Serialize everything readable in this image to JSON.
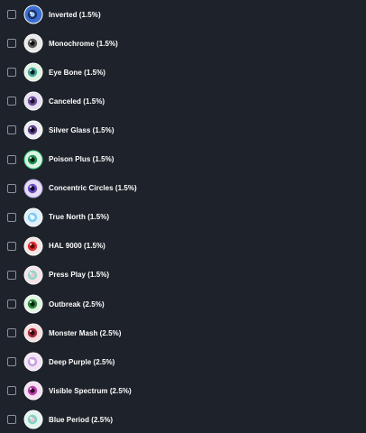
{
  "items": [
    {
      "label": "Inverted (1.5%)",
      "icon": "inverted-eyeball-icon",
      "sclera": "#3a6fd0",
      "rim": "#ffffff",
      "iris": "#1b2f6b",
      "pupil": "#9fd0ff"
    },
    {
      "label": "Monochrome (1.5%)",
      "icon": "monochrome-eyeball-icon",
      "sclera": "#e9e9e9",
      "rim": "#ffffff",
      "iris": "#5a5a5a",
      "pupil": "#111111"
    },
    {
      "label": "Eye Bone (1.5%)",
      "icon": "eye-bone-eyeball-icon",
      "sclera": "#dff3df",
      "rim": "#ffffff",
      "iris": "#3ea8a0",
      "pupil": "#0f1a1a"
    },
    {
      "label": "Canceled (1.5%)",
      "icon": "canceled-eyeball-icon",
      "sclera": "#e6dff0",
      "rim": "#ffffff",
      "iris": "#6a4aa0",
      "pupil": "#1a1024"
    },
    {
      "label": "Silver Glass (1.5%)",
      "icon": "silver-glass-eyeball-icon",
      "sclera": "#ececf2",
      "rim": "#ffffff",
      "iris": "#5c3e8c",
      "pupil": "#120a1e"
    },
    {
      "label": "Poison Plus (1.5%)",
      "icon": "poison-plus-eyeball-icon",
      "sclera": "#d9f5e4",
      "rim": "#3fd48a",
      "iris": "#1e8f52",
      "pupil": "#0c1a12"
    },
    {
      "label": "Concentric Circles (1.5%)",
      "icon": "concentric-circles-eyeball-icon",
      "sclera": "#e6def6",
      "rim": "#b9a4e8",
      "iris": "#6b4dc4",
      "pupil": "#140c2a"
    },
    {
      "label": "True North (1.5%)",
      "icon": "true-north-eyeball-icon",
      "sclera": "#dff0fb",
      "rim": "#ffffff",
      "iris": "#7fc8f0",
      "pupil": "#e8f6ff"
    },
    {
      "label": "HAL 9000 (1.5%)",
      "icon": "hal-9000-eyeball-icon",
      "sclera": "#f4e6e6",
      "rim": "#ffffff",
      "iris": "#e03030",
      "pupil": "#5a0a0a"
    },
    {
      "label": "Press Play (1.5%)",
      "icon": "press-play-eyeball-icon",
      "sclera": "#f6e2ea",
      "rim": "#ffffff",
      "iris": "#8fd9c8",
      "pupil": "#f0c6d6"
    },
    {
      "label": "Outbreak (2.5%)",
      "icon": "outbreak-eyeball-icon",
      "sclera": "#e2f6e2",
      "rim": "#ffffff",
      "iris": "#2c8a3c",
      "pupil": "#0e1a0e"
    },
    {
      "label": "Monster Mash (2.5%)",
      "icon": "monster-mash-eyeball-icon",
      "sclera": "#f6dede",
      "rim": "#ffffff",
      "iris": "#a82a3a",
      "pupil": "#2a0a10"
    },
    {
      "label": "Deep Purple (2.5%)",
      "icon": "deep-purple-eyeball-icon",
      "sclera": "#f4e4f6",
      "rim": "#ffffff",
      "iris": "#c8a0e0",
      "pupil": "#ffffff"
    },
    {
      "label": "Visible Spectrum (2.5%)",
      "icon": "visible-spectrum-eyeball-icon",
      "sclera": "#f6dff2",
      "rim": "#ffffff",
      "iris": "#c040b0",
      "pupil": "#2a0a26"
    },
    {
      "label": "Blue Period (2.5%)",
      "icon": "blue-period-eyeball-icon",
      "sclera": "#e2f4ee",
      "rim": "#ffffff",
      "iris": "#7fd2c0",
      "pupil": "#f2c6d8"
    }
  ],
  "checkbox_color": "#8a929c",
  "background": "#1e232b"
}
